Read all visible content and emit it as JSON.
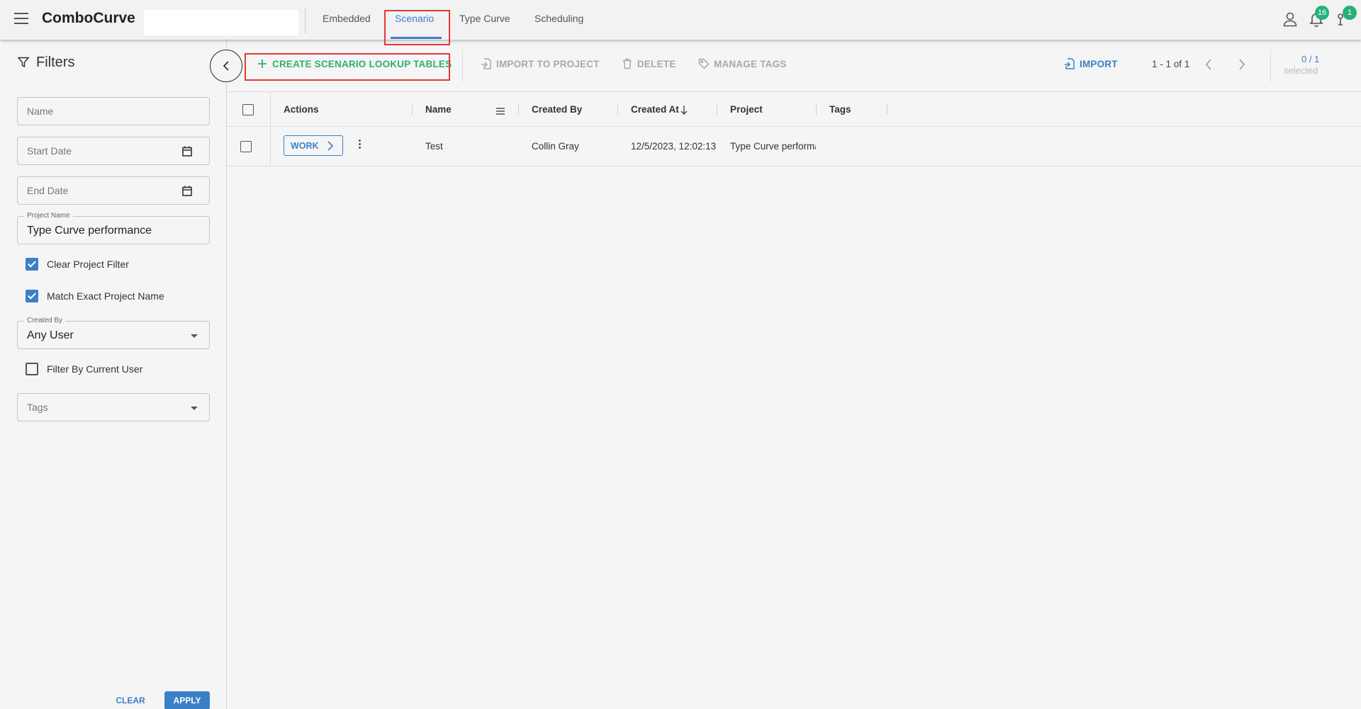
{
  "header": {
    "brand": "ComboCurve",
    "tabs": [
      {
        "label": "Embedded"
      },
      {
        "label": "Scenario"
      },
      {
        "label": "Type Curve"
      },
      {
        "label": "Scheduling"
      }
    ],
    "notifications_badge": "16",
    "jobs_badge": "1"
  },
  "filters": {
    "title": "Filters",
    "name_placeholder": "Name",
    "start_date_placeholder": "Start Date",
    "end_date_placeholder": "End Date",
    "project_name_label": "Project Name",
    "project_name_value": "Type Curve performance",
    "clear_project_filter": "Clear Project Filter",
    "match_exact_project_name": "Match Exact Project Name",
    "created_by_label": "Created By",
    "created_by_value": "Any User",
    "filter_by_current_user": "Filter By Current User",
    "tags_placeholder": "Tags",
    "clear_label": "CLEAR",
    "apply_label": "APPLY"
  },
  "toolbar": {
    "create_label": "CREATE SCENARIO LOOKUP TABLES",
    "import_to_project_label": "IMPORT TO PROJECT",
    "delete_label": "DELETE",
    "manage_tags_label": "MANAGE TAGS",
    "import_label": "IMPORT",
    "pagination": "1 - 1 of 1",
    "selected_count": "0 / 1",
    "selected_label": "selected"
  },
  "table": {
    "columns": [
      "Actions",
      "Name",
      "Created By",
      "Created At",
      "Project",
      "Tags"
    ],
    "rows": [
      {
        "action_label": "WORK",
        "name": "Test",
        "created_by": "Collin Gray",
        "created_at": "12/5/2023, 12:02:13",
        "project": "Type Curve performance",
        "tags": ""
      }
    ]
  },
  "colors": {
    "accent_blue": "#3a80c8",
    "accent_green": "#2fae74",
    "highlight_red": "#e53935",
    "badge_green": "#26b07a"
  }
}
